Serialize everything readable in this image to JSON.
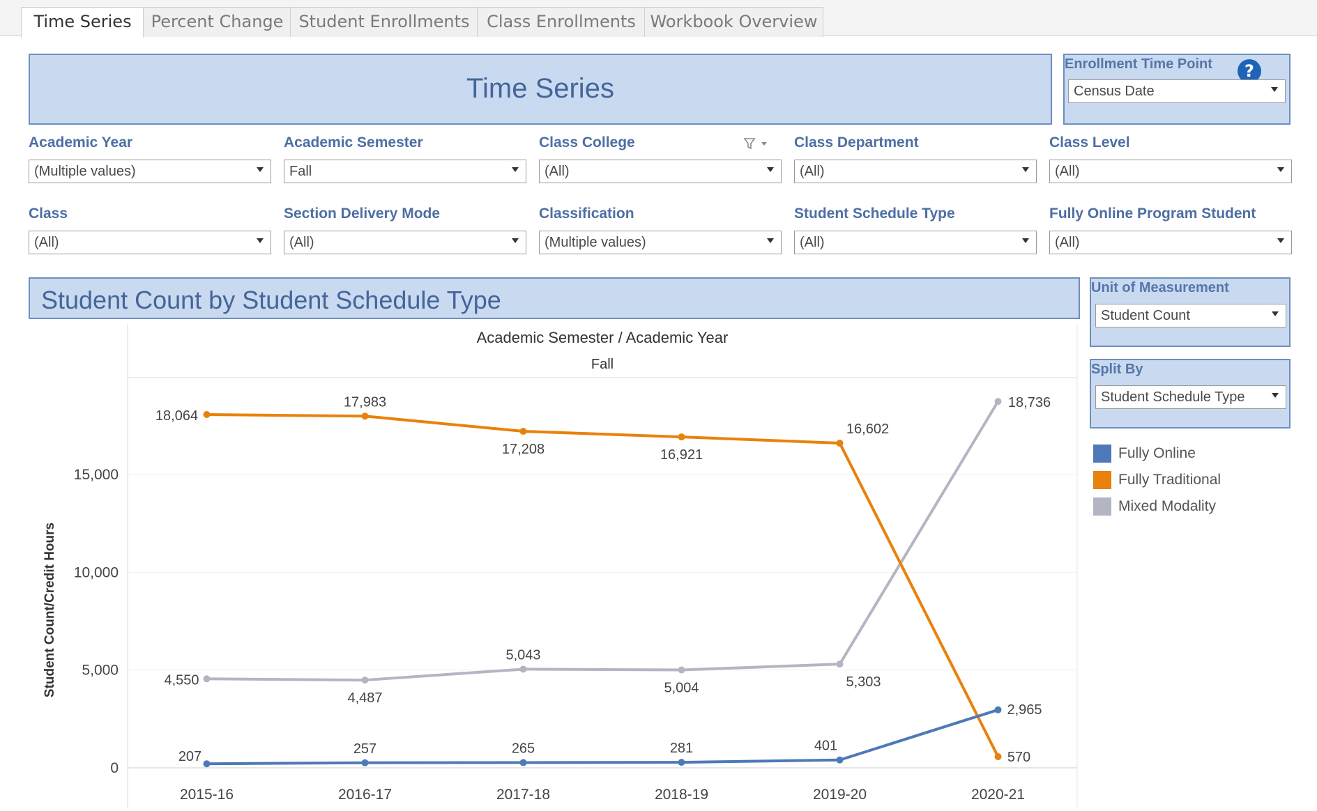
{
  "tabs": [
    "Time Series",
    "Percent Change",
    "Student Enrollments",
    "Class Enrollments",
    "Workbook Overview"
  ],
  "main_title": "Time Series",
  "enrollment_time_point": {
    "label": "Enrollment Time Point",
    "value": "Census Date",
    "help_glyph": "?"
  },
  "filters": [
    {
      "label": "Academic Year",
      "value": "(Multiple values)"
    },
    {
      "label": "Academic Semester",
      "value": "Fall"
    },
    {
      "label": "Class College",
      "value": "(All)"
    },
    {
      "label": "Class Department",
      "value": "(All)"
    },
    {
      "label": "Class Level",
      "value": "(All)"
    },
    {
      "label": "Class",
      "value": "(All)"
    },
    {
      "label": "Section Delivery Mode",
      "value": "(All)"
    },
    {
      "label": "Classification",
      "value": "(Multiple values)"
    },
    {
      "label": "Student Schedule Type",
      "value": "(All)"
    },
    {
      "label": "Fully Online Program Student",
      "value": "(All)"
    }
  ],
  "chart_title": "Student Count by Student Schedule Type",
  "unit_of_measurement": {
    "label": "Unit of Measurement",
    "value": "Student Count"
  },
  "split_by": {
    "label": "Split By",
    "value": "Student Schedule Type"
  },
  "colors": {
    "fully_online": "#4e79b8",
    "fully_traditional": "#e8820c",
    "mixed_modality": "#b3b6c2",
    "header_blue": "#c9daf0"
  },
  "icons": {
    "filter": "filter-funnel-icon",
    "help": "help-question-icon",
    "dropdown": "chevron-down-icon"
  },
  "chart_data": {
    "type": "line",
    "header": "Academic Semester / Academic Year",
    "pane_label": "Fall",
    "ylabel": "Student Count/Credit Hours",
    "ylim": [
      0,
      20000
    ],
    "yticks": [
      0,
      5000,
      10000,
      15000
    ],
    "ytick_labels": [
      "0",
      "5,000",
      "10,000",
      "15,000"
    ],
    "grid": true,
    "x": [
      "2015-16",
      "2016-17",
      "2017-18",
      "2018-19",
      "2019-20",
      "2020-21"
    ],
    "series": [
      {
        "name": "Fully Online",
        "color": "#4e79b8",
        "values": [
          207,
          257,
          265,
          281,
          401,
          2965
        ],
        "labels": [
          "207",
          "257",
          "265",
          "281",
          "401",
          "2,965"
        ]
      },
      {
        "name": "Fully Traditional",
        "color": "#e8820c",
        "values": [
          18064,
          17983,
          17208,
          16921,
          16602,
          570
        ],
        "labels": [
          "18,064",
          "17,983",
          "17,208",
          "16,921",
          "16,602",
          "570"
        ]
      },
      {
        "name": "Mixed Modality",
        "color": "#b3b6c2",
        "values": [
          4550,
          4487,
          5043,
          5004,
          5303,
          18736
        ],
        "labels": [
          "4,550",
          "4,487",
          "5,043",
          "5,004",
          "5,303",
          "18,736"
        ]
      }
    ],
    "legend_placement": "right"
  }
}
